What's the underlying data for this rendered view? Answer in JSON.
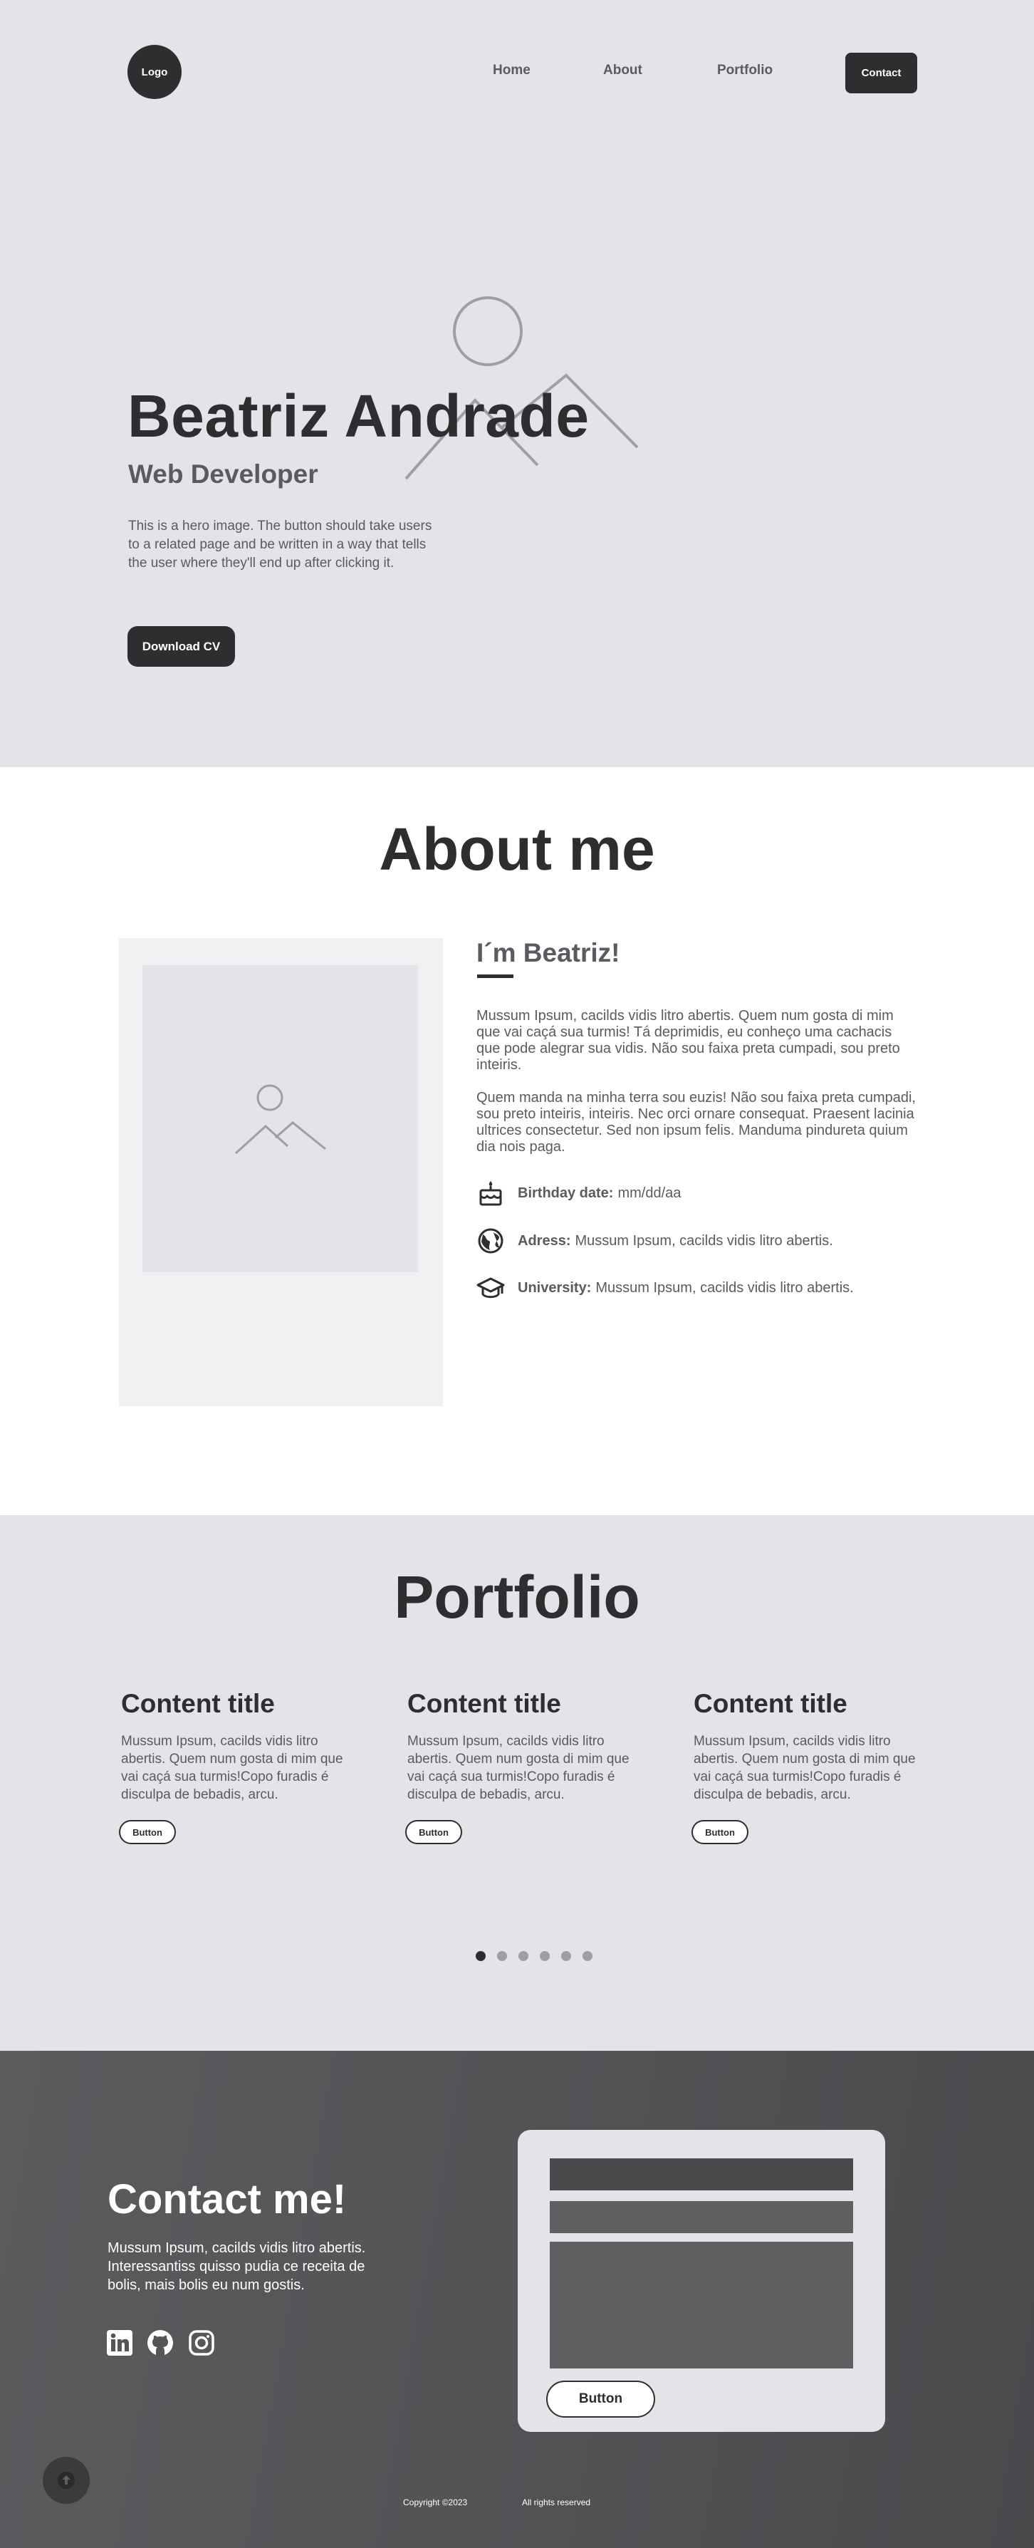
{
  "nav": {
    "logo": "Logo",
    "links": [
      "Home",
      "About",
      "Portfolio"
    ],
    "contact": "Contact"
  },
  "hero": {
    "name": "Beatriz Andrade",
    "role": "Web Developer",
    "text": "This is a hero image. The button should take users to a related page and be written in a way that tells the user where they'll end up after clicking it.",
    "button": "Download CV",
    "image_icon": "image-placeholder-icon"
  },
  "about": {
    "title": "About me",
    "subtitle": "I´m Beatriz!",
    "para1": "Mussum Ipsum, cacilds vidis litro abertis. Quem num gosta di mim que vai caçá sua turmis! Tá deprimidis, eu conheço uma cachacis que pode alegrar sua vidis. Não sou faixa preta cumpadi, sou preto inteiris.",
    "para2": "Quem manda na minha terra sou euzis! Não sou faixa preta cumpadi, sou preto inteiris, inteiris. Nec orci ornare consequat. Praesent lacinia ultrices consectetur. Sed non ipsum felis. Manduma pindureta quium dia nois paga.",
    "info": [
      {
        "icon": "cake-icon",
        "label": "Birthday date:",
        "value": "mm/dd/aa"
      },
      {
        "icon": "globe-icon",
        "label": "Adress:",
        "value": "Mussum Ipsum, cacilds vidis litro abertis."
      },
      {
        "icon": "graduation-cap-icon",
        "label": "University:",
        "value": "Mussum Ipsum, cacilds vidis litro abertis."
      }
    ]
  },
  "portfolio": {
    "title": "Portfolio",
    "cards": [
      {
        "title": "Content title",
        "text": "Mussum Ipsum, cacilds vidis litro abertis. Quem num gosta di mim que vai caçá sua turmis!Copo furadis é disculpa de bebadis, arcu.",
        "button": "Button"
      },
      {
        "title": "Content title",
        "text": "Mussum Ipsum, cacilds vidis litro abertis. Quem num gosta di mim que vai caçá sua turmis!Copo furadis é disculpa de bebadis, arcu.",
        "button": "Button"
      },
      {
        "title": "Content title",
        "text": "Mussum Ipsum, cacilds vidis litro abertis. Quem num gosta di mim que vai caçá sua turmis!Copo furadis é disculpa de bebadis, arcu.",
        "button": "Button"
      }
    ],
    "carousel": {
      "count": 6,
      "active": 1
    }
  },
  "contact": {
    "title": "Contact me!",
    "text": "Mussum Ipsum, cacilds vidis litro abertis. Interessantiss quisso pudia ce receita de bolis, mais bolis eu num gostis.",
    "social_icons": [
      "linkedin-icon",
      "github-icon",
      "instagram-icon"
    ],
    "form_button": "Button"
  },
  "footer": {
    "copyright": "Copyright ©2023",
    "rights": "All rights reserved"
  },
  "colors": {
    "dark": "#2e2e30",
    "muted": "#5a5a60",
    "light_bg": "#e3e3e8",
    "footer_bg": "#4a4a4d"
  }
}
